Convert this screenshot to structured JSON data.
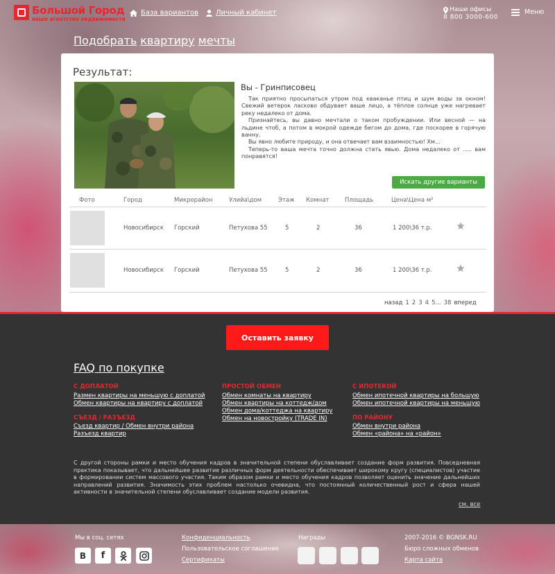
{
  "header": {
    "logo_name": "Большой Город",
    "logo_tagline": "ваше агентство недвижимости",
    "nav_base": "База вариантов",
    "nav_cabinet": "Личный кабинет",
    "offices_label": "Наши офисы",
    "phone": "8 800 3000-600",
    "menu_label": "Меню"
  },
  "page_title": {
    "word1": "Подобрать",
    "word2": "квартиру",
    "word3": "мечты"
  },
  "result": {
    "heading": "Результат:",
    "title": "Вы - Гринписовец",
    "paragraphs": [
      "Так приятно просыпаться утром под кваканье птиц и шум воды за окном! Свежий ветерок ласково обдувает ваше лицо, а тёплое солнце уже нагревает реку недалеко от дома.",
      "Признайтесь, вы давно мечтали о таком пробуждении. Или весной — на льдине чтоб, а потом в мокрой одежде бегом до дома, где поскорее в горячую ванну.",
      "Вы явно любите природу, и она отвечает вам взаимностью! Хм...",
      "Теперь-то ваша мечта точно должна стать явью. Дома недалеко от ..... вам понравятся!"
    ],
    "search_other_button": "Искать другие варианты"
  },
  "table": {
    "headers": [
      "Фото",
      "Город",
      "Микрорайон",
      "Улийа\\дом",
      "Этаж",
      "Комнат",
      "Площадь",
      "Цена\\Цена м²"
    ],
    "rows": [
      {
        "city": "Новосибирск",
        "district": "Горский",
        "address": "Петухова 55",
        "floor": "5",
        "rooms": "2",
        "area": "36",
        "price": "1 200\\36 т.р."
      },
      {
        "city": "Новосибирск",
        "district": "Горский",
        "address": "Петухова 55",
        "floor": "5",
        "rooms": "2",
        "area": "36",
        "price": "1 200\\36 т.р."
      }
    ]
  },
  "pagination": {
    "prev": "назад",
    "pages": [
      "1",
      "2",
      "3",
      "4",
      "5"
    ],
    "ellipsis": "...",
    "last": "38",
    "next": "вперед"
  },
  "cta_button": "Оставить заявку",
  "faq": {
    "title": "FAQ по покупке",
    "categories": [
      {
        "title": "С ДОПЛАТОЙ",
        "links": [
          "Размен квартиры на меньшую с доплатой",
          "Обмен квартиры на квартиру с доплатой"
        ]
      },
      {
        "title": "СЪЕЗД / РАЗЪЕЗД",
        "links": [
          "Съезд квартир / Обмен внутри района",
          "Разъезд квартир"
        ]
      },
      {
        "title": "ПРОСТОЙ ОБМЕН",
        "links": [
          "Обмен комнаты на квартиру",
          "Обмен квартиры на коттедж/дом",
          "Обмен дома/коттеджа на квартиру",
          "Обмен на новостройку (TRADE IN)"
        ]
      },
      {
        "title": "С ИПОТЕКОЙ",
        "links": [
          "Обмен ипотечной квартиры на большую",
          "Обмен ипотечной квартиры на меньшую"
        ]
      },
      {
        "title": "ПО РАЙОНУ",
        "links": [
          "Обмен внутри района",
          "Обмен «района» на «район»"
        ]
      }
    ],
    "paragraph": "С другой стороны рамки и место обучения кадров в значительной степени обуславливает создание форм развития. Повседневная практика показывает, что дальнейшее развитие различных форм деятельности обеспечивает широкому кругу (специалистов) участие в формировании систем массового участия. Таким образом рамки и место обучения кадров позволяет оценить значение дальнейших направлений развития. Значимость этих проблем настолько очевидна, что постоянный количественный рост и сфера нашей активности в значительной степени обуславливает создание модели развития.",
    "see_all": "см. все"
  },
  "footer": {
    "social_label": "Мы в соц. сетях",
    "links": [
      "Конфиденциальность",
      "Пользовательское соглашение",
      "Сертификаты"
    ],
    "awards_label": "Награды",
    "copyright": "2007-2016 © BGNSK.RU",
    "bureau": "Бюро сложных обменов",
    "sitemap": "Карта сайта"
  },
  "colors": {
    "accent": "#e8262e",
    "cta": "#ff1a1a",
    "green_button": "#4caa45",
    "dark_bg": "#333333"
  }
}
